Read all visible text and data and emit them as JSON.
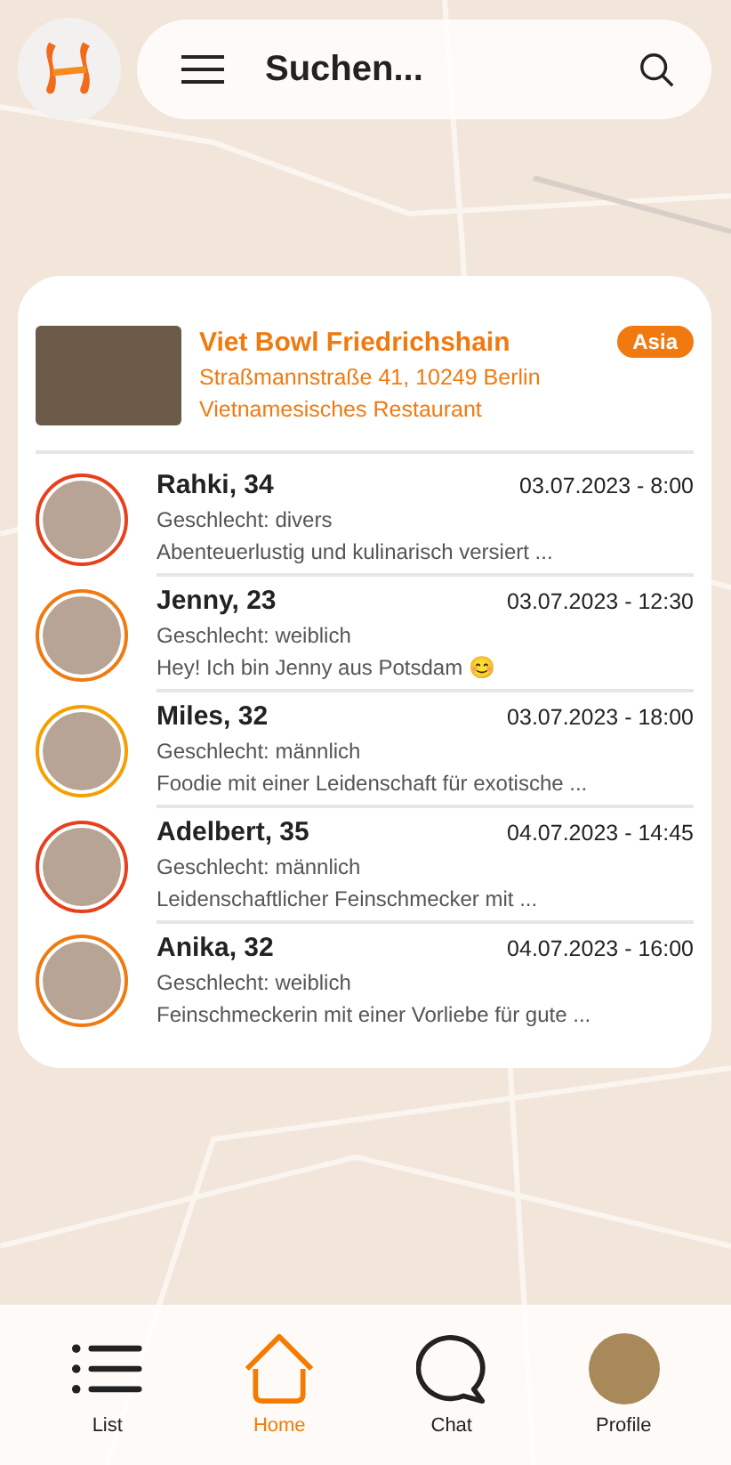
{
  "search": {
    "placeholder": "Suchen..."
  },
  "restaurant": {
    "name": "Viet Bowl Friedrichshain",
    "tag": "Asia",
    "address": "Straßmannstraße 41, 10249 Berlin",
    "type": "Vietnamesisches Restaurant"
  },
  "people": [
    {
      "name": "Rahki, 34",
      "date": "03.07.2023 - 8:00",
      "gender": "Geschlecht: divers",
      "bio": "Abenteuerlustig und kulinarisch versiert ...",
      "color": "#e8401c"
    },
    {
      "name": "Jenny, 23",
      "date": "03.07.2023 - 12:30",
      "gender": "Geschlecht: weiblich",
      "bio": "Hey! Ich bin Jenny aus Potsdam 😊",
      "color": "#f07a10"
    },
    {
      "name": "Miles, 32",
      "date": "03.07.2023 - 18:00",
      "gender": "Geschlecht: männlich",
      "bio": "Foodie mit einer Leidenschaft für exotische ...",
      "color": "#f5a000"
    },
    {
      "name": "Adelbert, 35",
      "date": "04.07.2023 - 14:45",
      "gender": "Geschlecht: männlich",
      "bio": "Leidenschaftlicher Feinschmecker mit ...",
      "color": "#e8401c"
    },
    {
      "name": "Anika, 32",
      "date": "04.07.2023 - 16:00",
      "gender": "Geschlecht: weiblich",
      "bio": "Feinschmeckerin mit einer Vorliebe für gute ...",
      "color": "#f07a10"
    }
  ],
  "nav": [
    {
      "label": "List",
      "kind": "list",
      "selected": false
    },
    {
      "label": "Home",
      "kind": "home",
      "selected": true
    },
    {
      "label": "Chat",
      "kind": "chat",
      "selected": false
    },
    {
      "label": "Profile",
      "kind": "avatar",
      "selected": false
    }
  ]
}
